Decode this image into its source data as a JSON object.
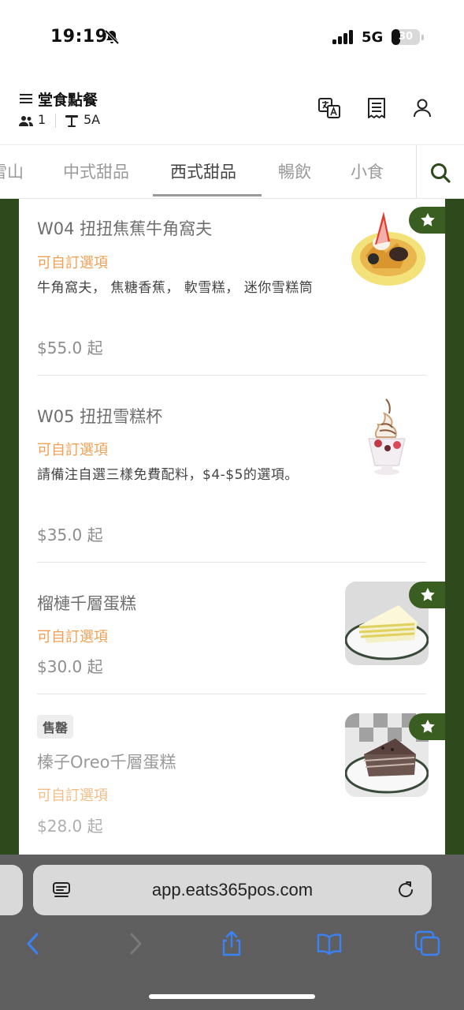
{
  "status_bar": {
    "time": "19:19",
    "network": "5G",
    "battery_level": "30",
    "battery_fraction": 0.3,
    "icons": [
      "bell-slash-icon",
      "signal-icon"
    ]
  },
  "header": {
    "title": "堂食點餐",
    "guest_count": "1",
    "table_number": "5A",
    "icons": [
      "menu-icon",
      "people-icon",
      "table-icon",
      "translate-icon",
      "receipt-icon",
      "user-icon"
    ]
  },
  "tabs": [
    {
      "label": "雪山"
    },
    {
      "label": "中式甜品"
    },
    {
      "label": "西式甜品",
      "active": true
    },
    {
      "label": "暢飲"
    },
    {
      "label": "小食"
    }
  ],
  "menu_items": [
    {
      "name": "W04 扭扭焦蕉牛角窩夫",
      "custom_label": "可自訂選項",
      "description": "牛角窩夫， 焦糖香蕉， 軟雪糕， 迷你雪糕筒",
      "price": "$55.0 起",
      "featured": true,
      "photo": "waffle-photo"
    },
    {
      "name": "W05 扭扭雪糕杯",
      "custom_label": "可自訂選項",
      "description": "請備注自選三樣免費配料，$4-$5的選項。",
      "price": "$35.0 起",
      "featured": false,
      "photo": "sundae-photo"
    },
    {
      "name": "榴槤千層蛋糕",
      "custom_label": "可自訂選項",
      "price": "$30.0 起",
      "featured": true,
      "photo": "durian-crepe-cake-photo"
    },
    {
      "name": "榛子Oreo千層蛋糕",
      "custom_label": "可自訂選項",
      "price": "$28.0 起",
      "featured": true,
      "sold_out": "售罄",
      "photo": "oreo-crepe-cake-photo"
    }
  ],
  "browser": {
    "url": "app.eats365pos.com",
    "icons": [
      "reader-icon",
      "reload-icon",
      "back-icon",
      "forward-icon",
      "share-icon",
      "bookmarks-icon",
      "tabs-icon"
    ]
  },
  "colors": {
    "brand_green": "#3a5e22",
    "side_green": "#2e4a1c",
    "custom_orange": "#f0a054"
  }
}
